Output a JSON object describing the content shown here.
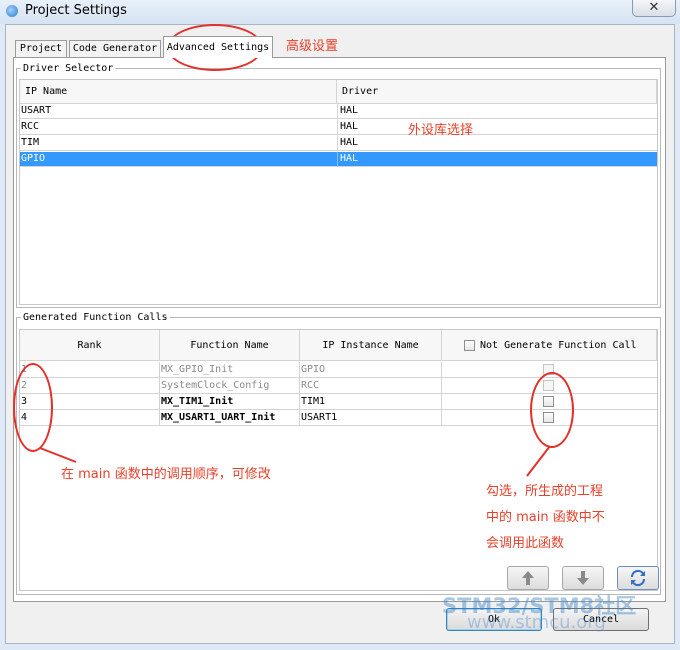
{
  "window": {
    "title": "Project Settings",
    "close_glyph": "✕"
  },
  "tabs": [
    {
      "label": "Project"
    },
    {
      "label": "Code Generator"
    },
    {
      "label": "Advanced Settings",
      "selected": true
    }
  ],
  "driver_selector": {
    "legend": "Driver Selector",
    "columns": [
      "IP Name",
      "Driver"
    ],
    "rows": [
      {
        "ip": "USART",
        "driver": "HAL"
      },
      {
        "ip": "RCC",
        "driver": "HAL"
      },
      {
        "ip": "TIM",
        "driver": "HAL"
      },
      {
        "ip": "GPIO",
        "driver": "HAL"
      }
    ],
    "selected_index": 3
  },
  "function_calls": {
    "legend": "Generated Function Calls",
    "columns": {
      "rank": "Rank",
      "function_name": "Function Name",
      "ip_instance": "IP Instance Name",
      "not_generate": "Not Generate Function Call"
    },
    "rows": [
      {
        "rank": "1",
        "function": "MX_GPIO_Init",
        "instance": "GPIO",
        "enabled": false
      },
      {
        "rank": "2",
        "function": "SystemClock_Config",
        "instance": "RCC",
        "enabled": false
      },
      {
        "rank": "3",
        "function": "MX_TIM1_Init",
        "instance": "TIM1",
        "enabled": true
      },
      {
        "rank": "4",
        "function": "MX_USART1_UART_Init",
        "instance": "USART1",
        "enabled": true
      }
    ]
  },
  "buttons": {
    "ok": "Ok",
    "cancel": "Cancel"
  },
  "annotations": {
    "advanced": "高级设置",
    "driver_choice": "外设库选择",
    "order": "在 main 函数中的调用顺序，可修改",
    "checkbox_note": [
      "勾选，所生成的工程",
      "中的 main 函数中不",
      "会调用此函数"
    ]
  },
  "watermark": {
    "main": "STM32/STM8社区",
    "sub": "www.stmcu.org"
  },
  "colors": {
    "selection": "#3399ff",
    "annotation": "#e8402a",
    "refresh_icon": "#2f6fc6"
  }
}
